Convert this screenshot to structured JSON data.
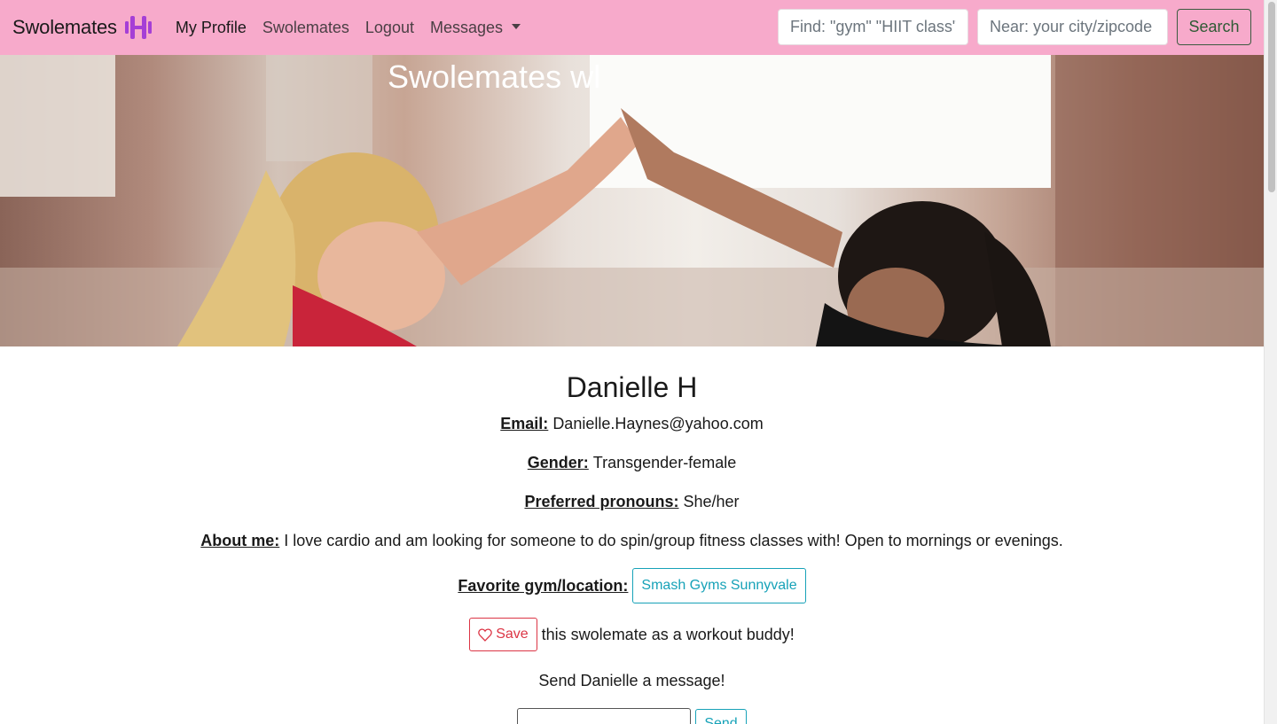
{
  "navbar": {
    "brand": "Swolemates",
    "brand_icon": "dumbbell-icon",
    "brand_color": "#a53fd6",
    "background": "#f7aacb",
    "links": [
      {
        "label": "My Profile"
      },
      {
        "label": "Swolemates"
      },
      {
        "label": "Logout"
      },
      {
        "label": "Messages"
      }
    ],
    "find_placeholder": "Find: \"gym\" \"HIIT class\"",
    "near_placeholder": "Near: your city/zipcode",
    "search_label": "Search"
  },
  "hero": {
    "title": "Swolemates wh"
  },
  "profile": {
    "name": "Danielle H",
    "email_label": "Email:",
    "email": "Danielle.Haynes@yahoo.com",
    "gender_label": "Gender:",
    "gender": "Transgender-female",
    "pronouns_label": "Preferred pronouns:",
    "pronouns": "She/her",
    "about_label": "About me:",
    "about": "I love cardio and am looking for someone to do spin/group fitness classes with! Open to mornings or evenings.",
    "gym_label": "Favorite gym/location:",
    "gym": "Smash Gyms Sunnyvale",
    "save_label": "Save",
    "save_text": "this swolemate as a workout buddy!",
    "send_prompt": "Send Danielle a message!",
    "message_value": "",
    "send_label": "Send"
  },
  "colors": {
    "info": "#17a2b8",
    "danger": "#dc3545",
    "search_button": "#2f5a35"
  }
}
